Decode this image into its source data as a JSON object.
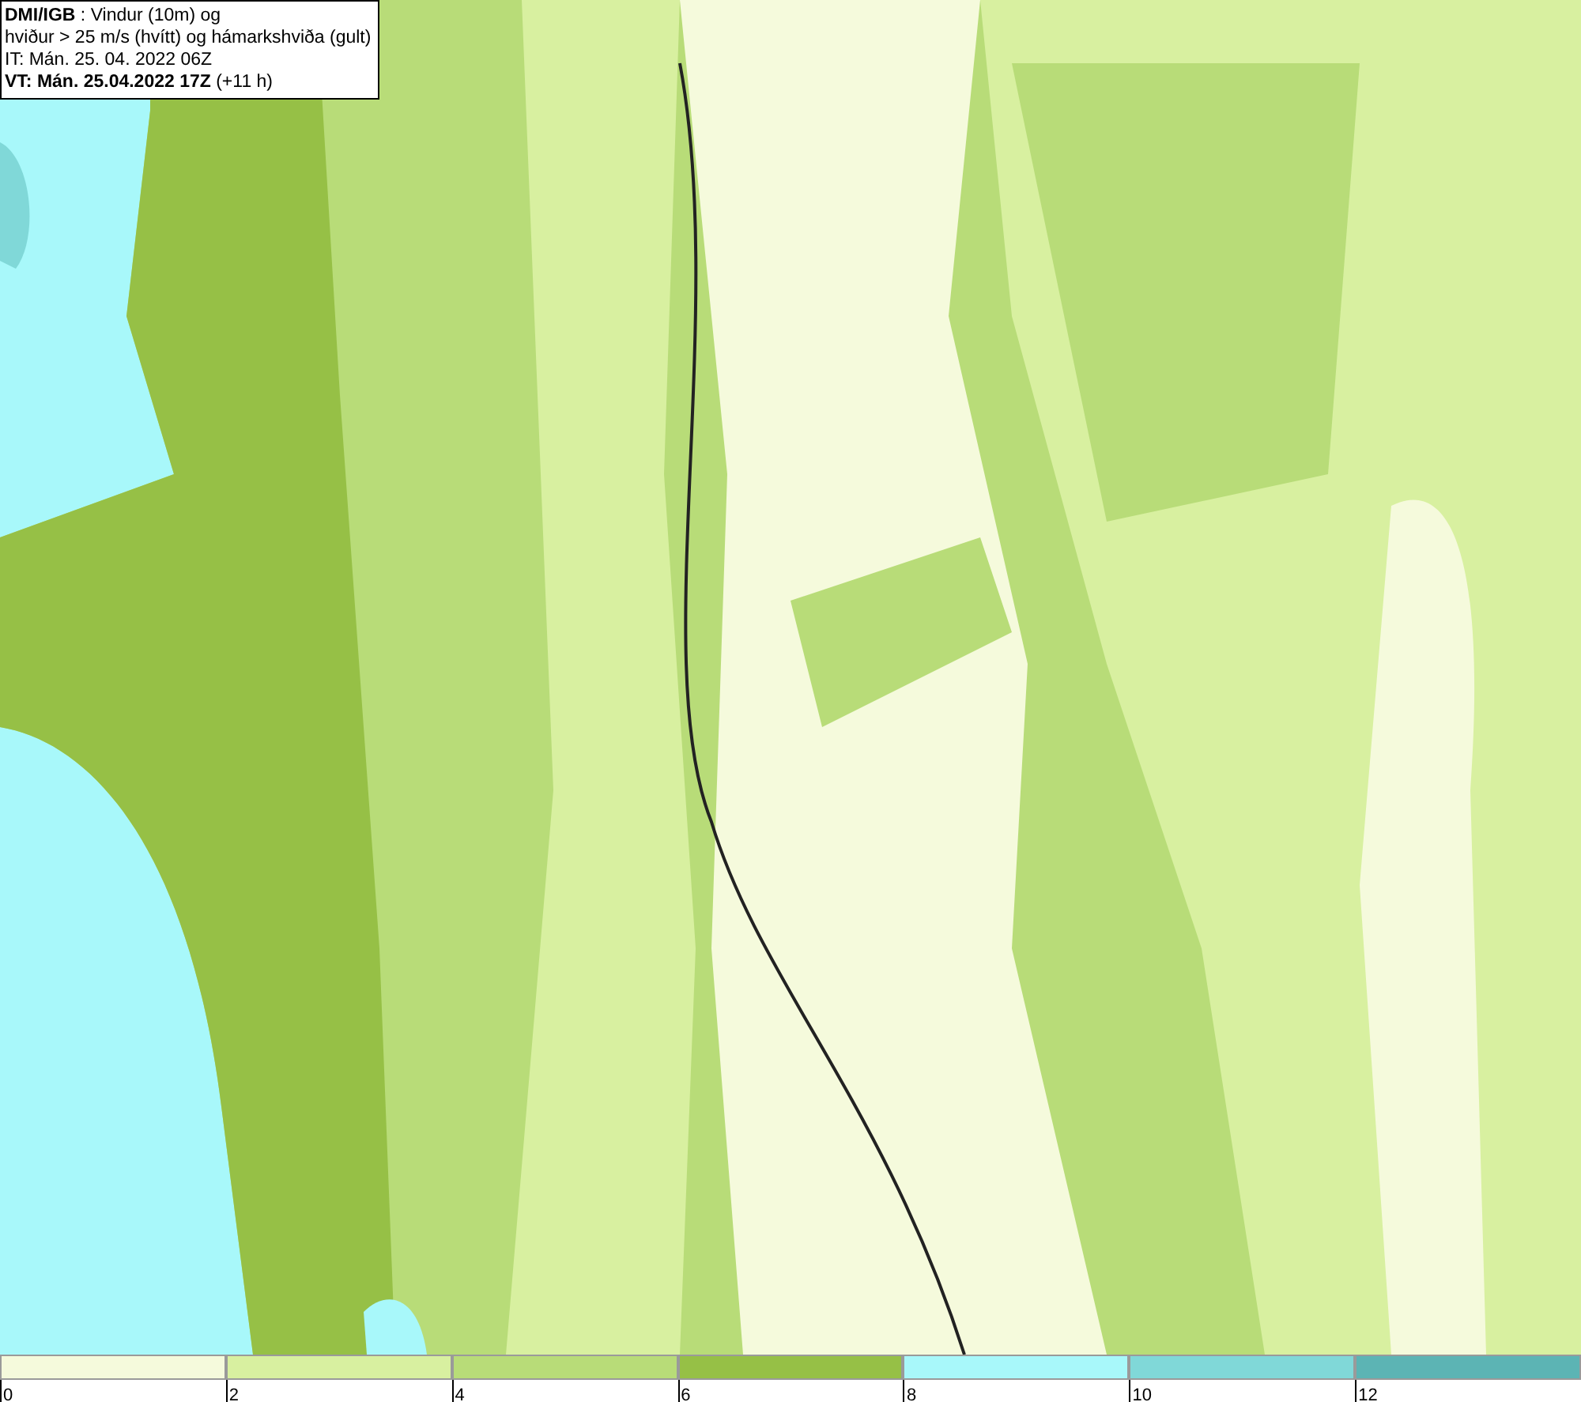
{
  "info_box": {
    "lines": [
      "**DMI/IGB** : Vindur (10m) og",
      "hviður > 25 m/s (hvítt) og hámarkshviða (gult)",
      "IT: Mán. 25. 04. 2022 06Z",
      "**VT: Mán. 25.04.2022 17Z** (+11 h)"
    ]
  },
  "legend": [
    {
      "color": "#f5fadc",
      "label": "0"
    },
    {
      "color": "#d8f0a0",
      "label": "2"
    },
    {
      "color": "#b8dc78",
      "label": "4"
    },
    {
      "color": "#96c046",
      "label": "6"
    },
    {
      "color": "#a8f8fa",
      "label": "8"
    },
    {
      "color": "#80d8d8",
      "label": "10"
    },
    {
      "color": "#5cb4b4",
      "label": "12"
    }
  ]
}
